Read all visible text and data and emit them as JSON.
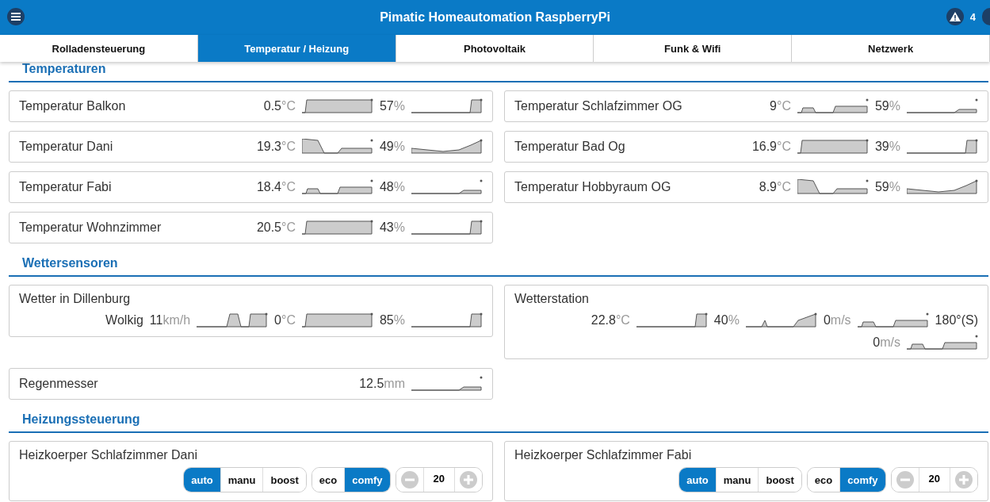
{
  "header": {
    "title": "Pimatic Homeautomation RaspberryPi",
    "alert_count": "4"
  },
  "tabs": [
    {
      "label": "Rolladensteuerung",
      "selected": false
    },
    {
      "label": "Temperatur / Heizung",
      "selected": true
    },
    {
      "label": "Photovoltaik",
      "selected": false
    },
    {
      "label": "Funk & Wifi",
      "selected": false
    },
    {
      "label": "Netzwerk",
      "selected": false
    }
  ],
  "sections": [
    {
      "title": "Temperaturen",
      "kind": "sensors",
      "cards": [
        {
          "name": "Temperatur Balkon",
          "lines": [
            [
              {
                "value": "0.5",
                "unit": "°C",
                "spark": true
              },
              {
                "value": "57",
                "unit": "%",
                "spark": true
              }
            ]
          ]
        },
        {
          "name": "Temperatur Schlafzimmer OG",
          "lines": [
            [
              {
                "value": "9",
                "unit": "°C",
                "spark": true
              },
              {
                "value": "59",
                "unit": "%",
                "spark": true
              }
            ]
          ]
        },
        {
          "name": "Temperatur Dani",
          "lines": [
            [
              {
                "value": "19.3",
                "unit": "°C",
                "spark": true
              },
              {
                "value": "49",
                "unit": "%",
                "spark": true
              }
            ]
          ]
        },
        {
          "name": "Temperatur Bad Og",
          "lines": [
            [
              {
                "value": "16.9",
                "unit": "°C",
                "spark": true
              },
              {
                "value": "39",
                "unit": "%",
                "spark": true
              }
            ]
          ]
        },
        {
          "name": "Temperatur Fabi",
          "lines": [
            [
              {
                "value": "18.4",
                "unit": "°C",
                "spark": true
              },
              {
                "value": "48",
                "unit": "%",
                "spark": true
              }
            ]
          ]
        },
        {
          "name": "Temperatur Hobbyraum OG",
          "lines": [
            [
              {
                "value": "8.9",
                "unit": "°C",
                "spark": true
              },
              {
                "value": "59",
                "unit": "%",
                "spark": true
              }
            ]
          ]
        },
        {
          "name": "Temperatur Wohnzimmer",
          "lines": [
            [
              {
                "value": "20.5",
                "unit": "°C",
                "spark": true
              },
              {
                "value": "43",
                "unit": "%",
                "spark": true
              }
            ]
          ]
        }
      ]
    },
    {
      "title": "Wettersensoren",
      "kind": "sensors",
      "cards": [
        {
          "name": "Wetter in Dillenburg",
          "stacked": true,
          "lines": [
            [
              {
                "value": "Wolkig",
                "spark": false
              },
              {
                "value": "11",
                "unit": "km/h",
                "spark": true
              },
              {
                "value": "0",
                "unit": "°C",
                "spark": true
              },
              {
                "value": "85",
                "unit": "%",
                "spark": true
              }
            ]
          ]
        },
        {
          "name": "Wetterstation",
          "stacked": true,
          "lines": [
            [
              {
                "value": "22.8",
                "unit": "°C",
                "spark": true
              },
              {
                "value": "40",
                "unit": "%",
                "spark": true
              },
              {
                "value": "0",
                "unit": "m/s",
                "spark": true
              },
              {
                "value": "180°(S)",
                "spark": false
              }
            ],
            [
              {
                "value": "0",
                "unit": "m/s",
                "spark": true
              }
            ]
          ]
        },
        {
          "name": "Regenmesser",
          "lines": [
            [
              {
                "value": "12.5",
                "unit": "mm",
                "spark": true
              }
            ]
          ]
        }
      ]
    },
    {
      "title": "Heizungssteuerung",
      "kind": "heating",
      "cards": [
        {
          "name": "Heizkoerper Schlafzimmer Dani",
          "modes": [
            {
              "label": "auto",
              "selected": true
            },
            {
              "label": "manu",
              "selected": false
            },
            {
              "label": "boost",
              "selected": false
            }
          ],
          "presets": [
            {
              "label": "eco",
              "selected": false
            },
            {
              "label": "comfy",
              "selected": true
            }
          ],
          "setpoint": "20"
        },
        {
          "name": "Heizkoerper Schlafzimmer Fabi",
          "modes": [
            {
              "label": "auto",
              "selected": true
            },
            {
              "label": "manu",
              "selected": false
            },
            {
              "label": "boost",
              "selected": false
            }
          ],
          "presets": [
            {
              "label": "eco",
              "selected": false
            },
            {
              "label": "comfy",
              "selected": true
            }
          ],
          "setpoint": "20"
        }
      ]
    }
  ]
}
